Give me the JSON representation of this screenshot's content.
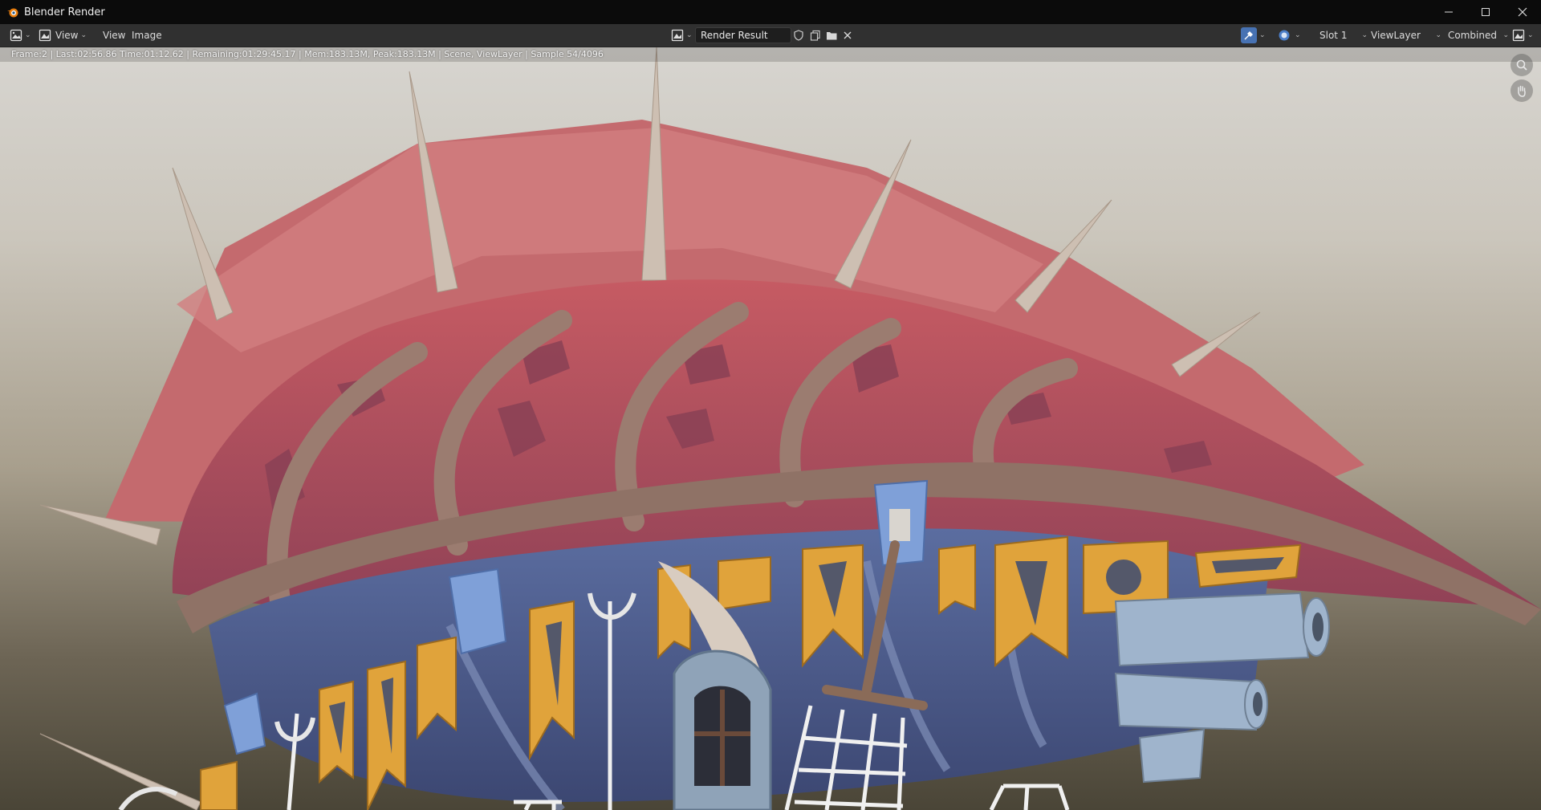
{
  "window": {
    "title": "Blender Render",
    "controls": [
      "minimize-icon",
      "maximize-icon",
      "close-icon"
    ]
  },
  "header": {
    "editor_type_icon": "image-editor-icon",
    "mode_icon": "view-mode-icon",
    "view_dropdown_label": "View",
    "menus": [
      "View",
      "Image"
    ],
    "image_browse_icon": "image-browse-icon",
    "image_name": "Render Result",
    "image_actions": [
      "fake-user-icon",
      "new-image-icon",
      "open-image-icon",
      "unlink-icon"
    ],
    "right": {
      "toggles": [
        "sample-tool-icon",
        "display-channels-icon"
      ],
      "slot": "Slot 1",
      "layer": "ViewLayer",
      "pass": "Combined",
      "display_mode_icon": "display-mode-icon"
    }
  },
  "viewport": {
    "info_text": "Frame:2 | Last:02:56.86 Time:01:12.62 | Remaining:01:29:45.17 | Mem:183.13M, Peak:183.13M | Scene, ViewLayer | Sample 54/4096",
    "gizmos": [
      "zoom-icon",
      "pan-hand-icon"
    ],
    "render_subject": "airship"
  },
  "colors": {
    "accent": "#4772b3",
    "titlebar_bg": "#0b0b0b",
    "header_bg": "#303030",
    "envelope_red": "#b85058",
    "banner_gold": "#e0a33b",
    "hull_blue": "#4a5c8c"
  }
}
